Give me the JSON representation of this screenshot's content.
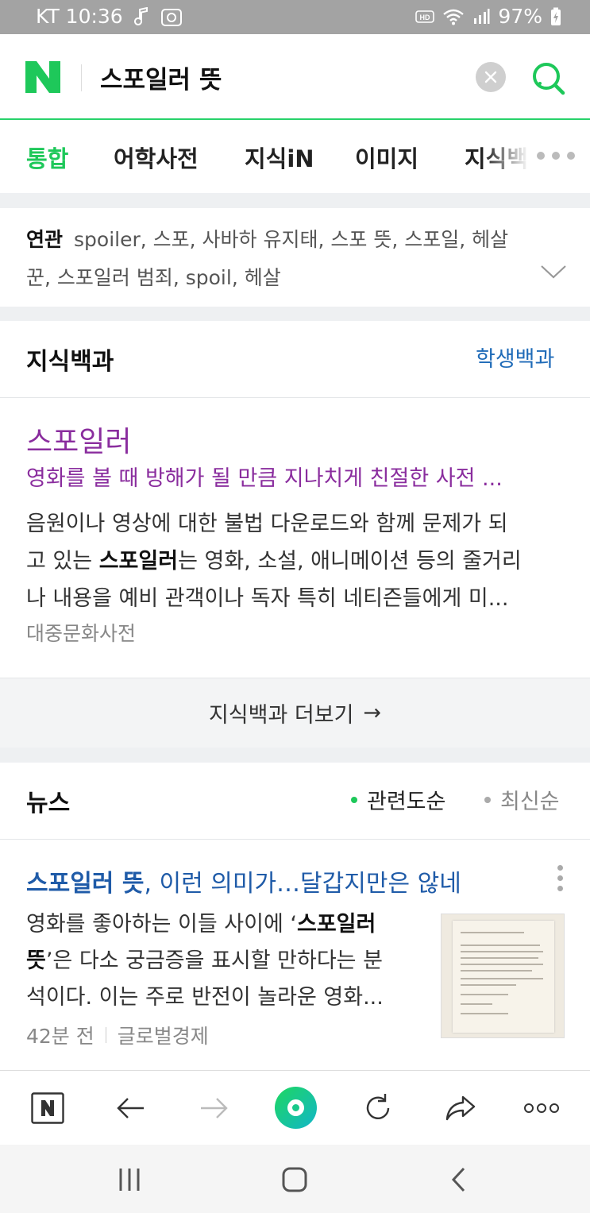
{
  "status_bar": {
    "carrier_time": "KT 10:36",
    "battery": "97%",
    "icons": [
      "music-note-icon",
      "camera-icon",
      "hd-icon",
      "wifi-icon",
      "signal-icon",
      "battery-charging-icon"
    ]
  },
  "search": {
    "query": "스포일러 뜻",
    "logo": "N"
  },
  "tabs": [
    {
      "label": "통합",
      "active": true
    },
    {
      "label": "어학사전"
    },
    {
      "label": "지식iN"
    },
    {
      "label": "이미지"
    },
    {
      "label": "지식백"
    }
  ],
  "related": {
    "label": "연관",
    "line1": "spoiler, 스포, 사바하 유지태, 스포 뜻, 스포일, 헤살",
    "line2": "꾼, 스포일러 범죄, spoil, 헤살"
  },
  "encyclopedia": {
    "section_title": "지식백과",
    "section_link": "학생백과",
    "entry_title": "스포일러",
    "entry_subtitle": "영화를 볼 때 방해가 될 만큼 지나치게 친절한 사전 ...",
    "body_line1": "음원이나 영상에 대한 불법 다운로드와 함께 문제가 되",
    "body_line2_pre": "고 있는 ",
    "body_line2_bold": "스포일러",
    "body_line2_post": "는 영화, 소설, 애니메이션 등의 줄거리",
    "body_line3": "나 내용을 예비 관객이나 독자 특히 네티즌들에게 미...",
    "source": "대중문화사전",
    "more_label": "지식백과 더보기",
    "more_arrow": "→"
  },
  "news": {
    "section_title": "뉴스",
    "sort_relevance": "관련도순",
    "sort_latest": "최신순",
    "item_title_bold": "스포일러 뜻",
    "item_title_rest": ", 이런 의미가…달갑지만은 않네",
    "body_line1_pre": "영화를 좋아하는 이들 사이에 ‘",
    "body_line1_bold": "스포일러",
    "body_line2_bold": "뜻",
    "body_line2_post": "’은 다소 궁금증을 표시할 만하다는 분",
    "body_line3": "석이다. 이는 주로 반전이 놀라운 영화...",
    "time": "42분 전",
    "press": "글로벌경제"
  },
  "colors": {
    "naver_green": "#1ec85a",
    "link_blue": "#1f5ba8",
    "purple": "#8a2d9e"
  }
}
